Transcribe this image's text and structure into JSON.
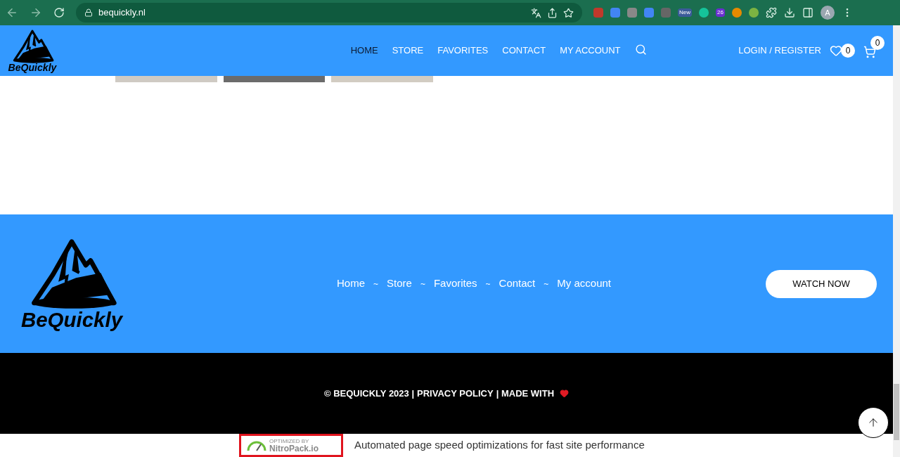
{
  "browser": {
    "url": "bequickly.nl",
    "extension_badges": [
      "New",
      "26"
    ],
    "profile_initial": "A"
  },
  "header": {
    "logo_text": "BeQuickly",
    "nav": [
      {
        "label": "HOME",
        "selected": true
      },
      {
        "label": "STORE",
        "selected": false
      },
      {
        "label": "FAVORITES",
        "selected": false
      },
      {
        "label": "CONTACT",
        "selected": false
      },
      {
        "label": "MY ACCOUNT",
        "selected": false
      }
    ],
    "login": "LOGIN / REGISTER",
    "wishlist_count": "0",
    "cart_count": "0"
  },
  "footer": {
    "logo_text": "BeQuickly",
    "links": [
      "Home",
      "Store",
      "Favorites",
      "Contact",
      "My account"
    ],
    "separator": "~",
    "button": "WATCH NOW"
  },
  "bottom": {
    "copyright": "© BEQUICKLY 2023 |",
    "privacy": "PRIVACY POLICY",
    "made_with": "| MADE WITH"
  },
  "nitropack": {
    "badge_small": "OPTIMIZED BY",
    "badge_brand": "NitroPack.io",
    "message": "Automated page speed optimizations for fast site performance"
  }
}
